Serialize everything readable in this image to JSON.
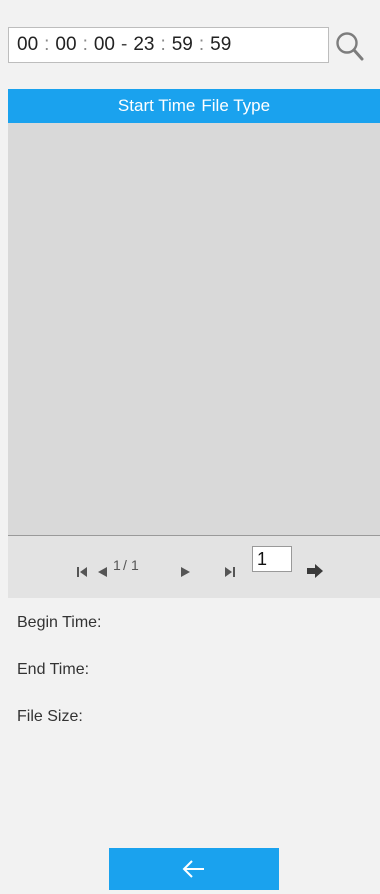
{
  "time_range": {
    "start": {
      "hh": "00",
      "mm": "00",
      "ss": "00"
    },
    "end": {
      "hh": "23",
      "mm": "59",
      "ss": "59"
    },
    "time_separator": ":",
    "range_separator": "-"
  },
  "icons": {
    "search": "search-icon",
    "first_page": "first-page-icon",
    "prev_page": "prev-page-icon",
    "next_page": "next-page-icon",
    "last_page": "last-page-icon",
    "go": "go-arrow-icon",
    "back": "back-arrow-icon"
  },
  "list": {
    "columns": [
      "Start Time",
      "File Type"
    ],
    "rows": []
  },
  "pager": {
    "current": "1",
    "slash": "/",
    "total": "1",
    "input_value": "1"
  },
  "details": {
    "begin_time_label": "Begin Time:",
    "end_time_label": "End Time:",
    "file_size_label": "File Size:"
  },
  "colors": {
    "accent": "#1aa2ee",
    "list_bg": "#d9d9d9",
    "page_bg": "#f2f2f2"
  }
}
